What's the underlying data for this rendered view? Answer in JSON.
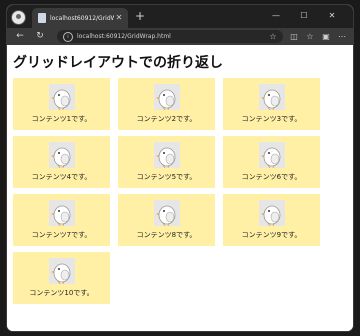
{
  "browser": {
    "tab": {
      "title": "localhost60912/GridWrap.html",
      "close": "✕"
    },
    "new_tab": "+",
    "window_controls": {
      "minimize": "—",
      "maximize": "☐",
      "close": "✕"
    },
    "nav": {
      "back": "←",
      "reload": "↻"
    },
    "address": "localhost:60912/GridWrap.html",
    "toolbar_icons": [
      "split-screen-icon",
      "favorites-icon",
      "collections-icon",
      "more-icon"
    ]
  },
  "page": {
    "heading": "グリッドレイアウトでの折り返し",
    "items": [
      "コンテンツ1です。",
      "コンテンツ2です。",
      "コンテンツ3です。",
      "コンテンツ4です。",
      "コンテンツ5です。",
      "コンテンツ6です。",
      "コンテンツ7です。",
      "コンテンツ8です。",
      "コンテンツ9です。",
      "コンテンツ10です。"
    ]
  },
  "colors": {
    "cell_background": "#fff0a6",
    "browser_frame": "#202020"
  }
}
